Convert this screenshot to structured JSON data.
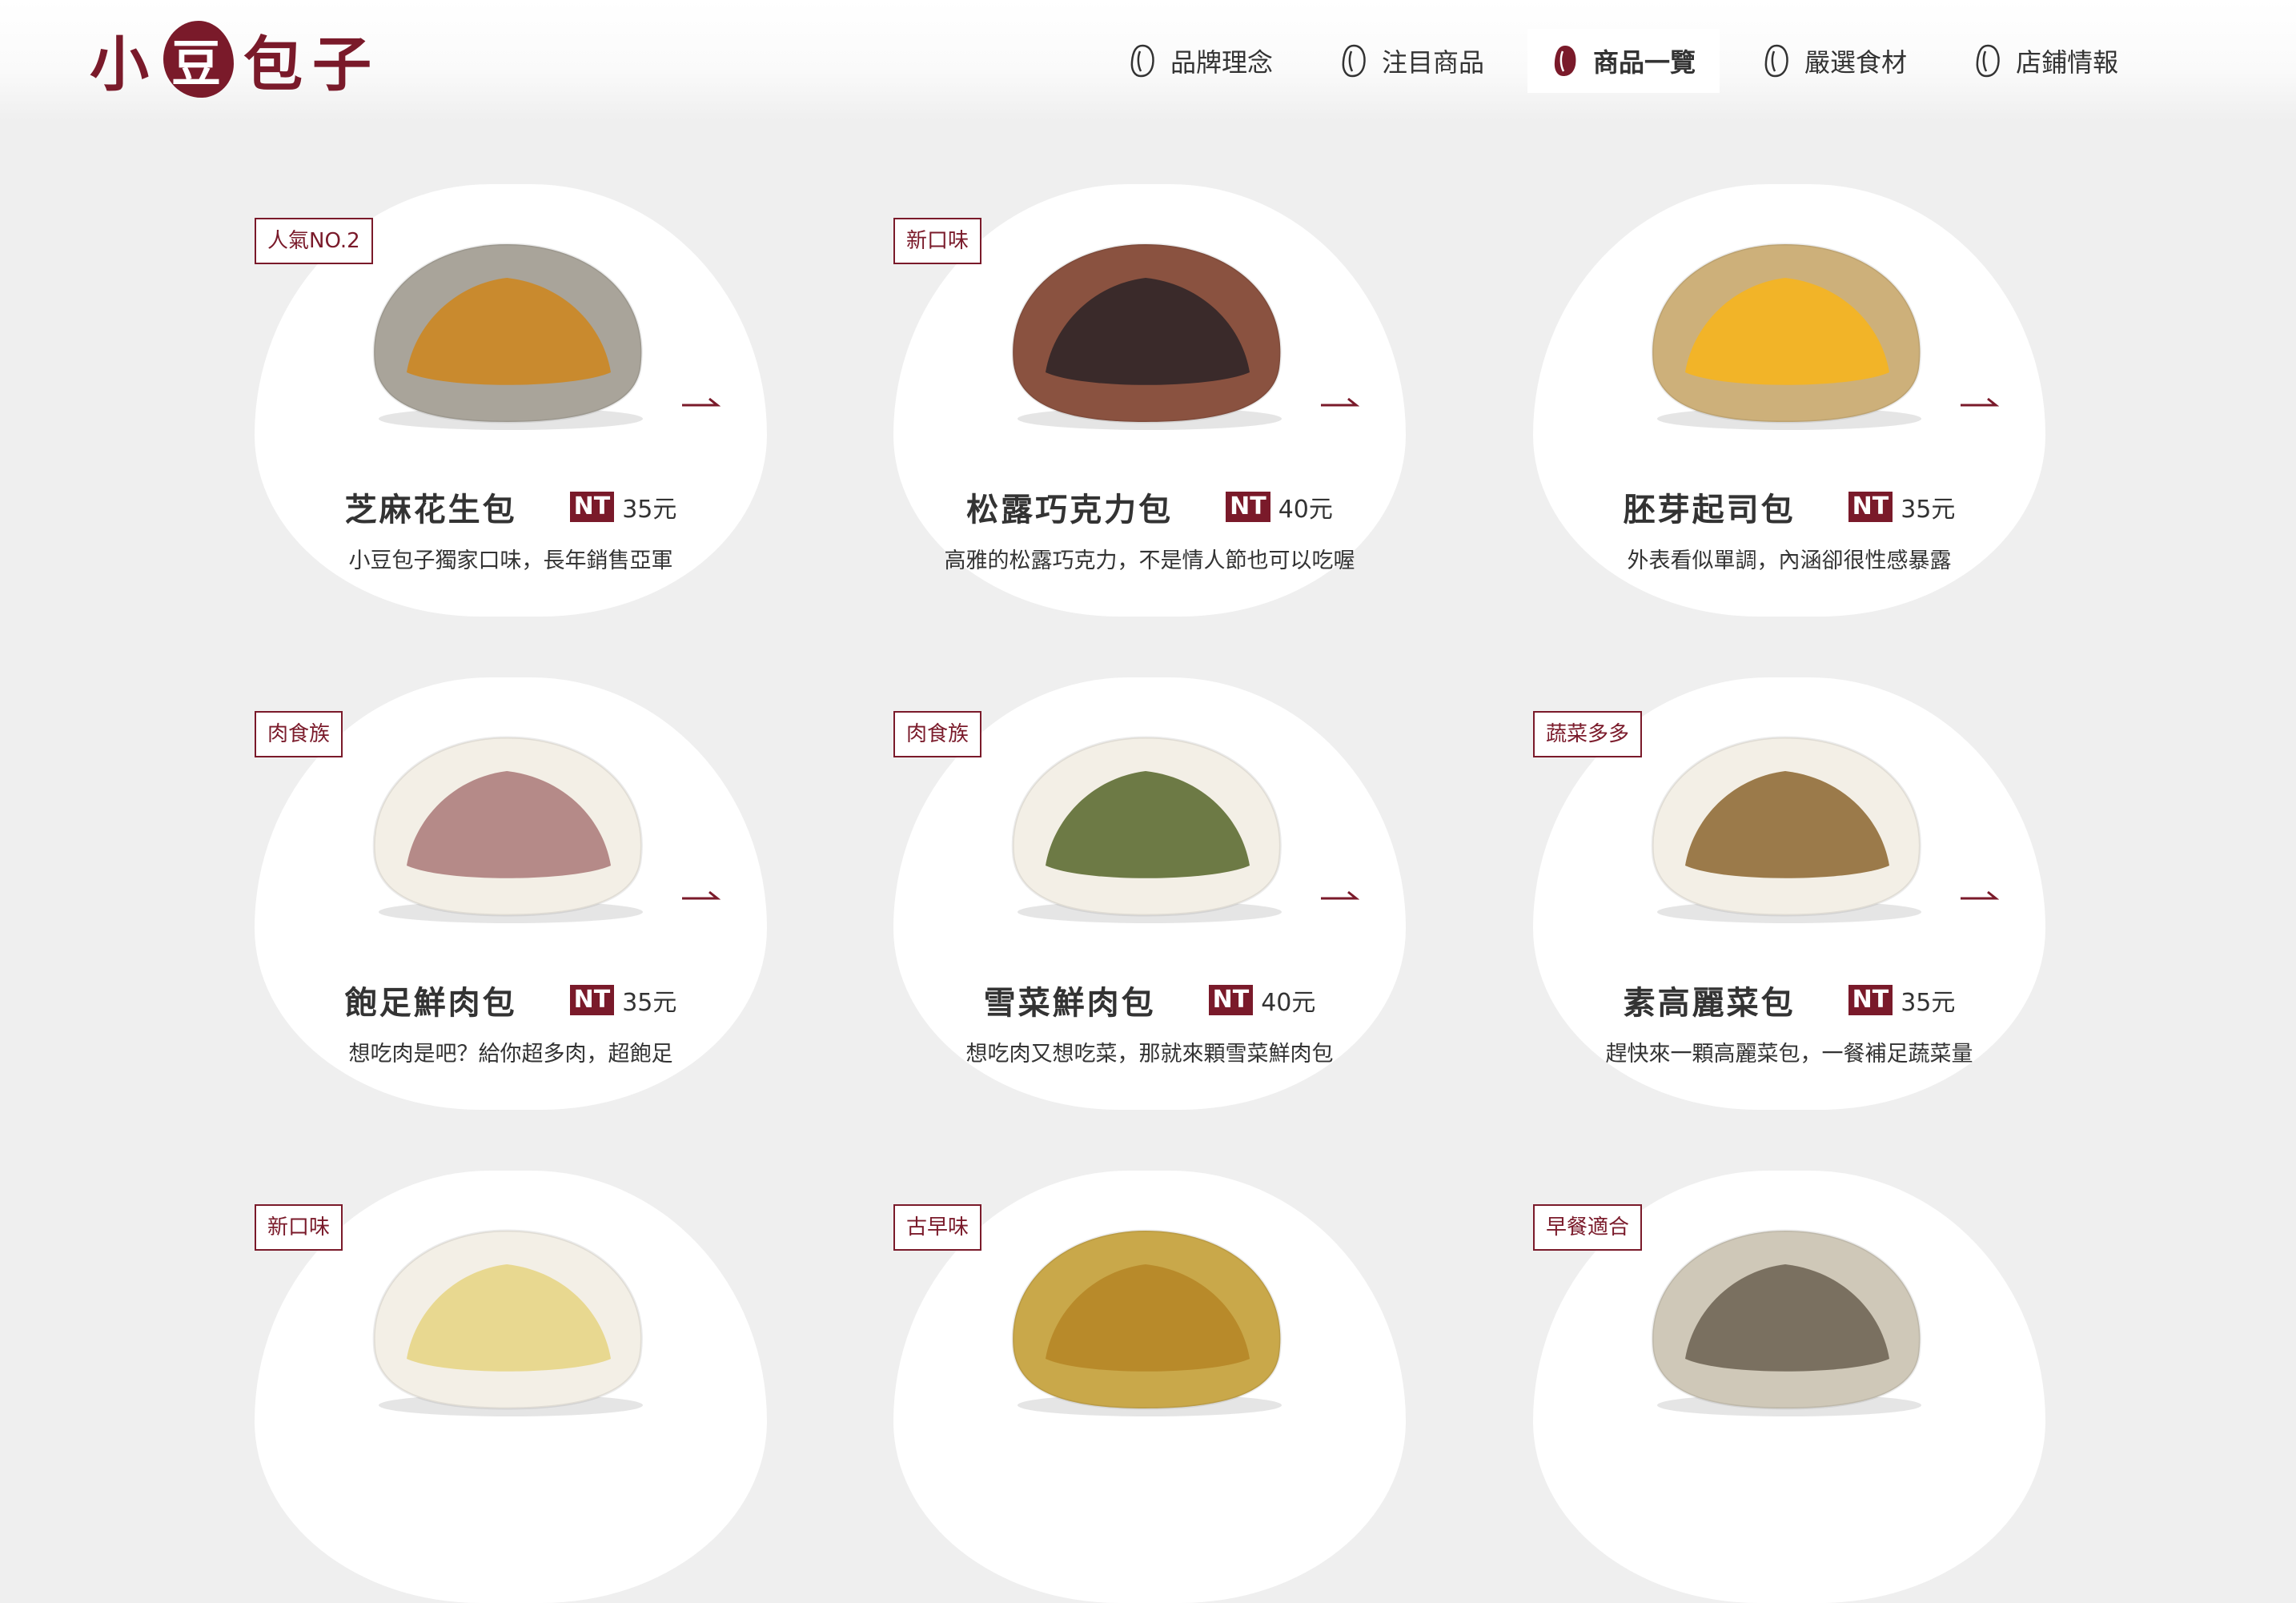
{
  "brand": {
    "logo_chars": [
      "小",
      "豆",
      "包",
      "子"
    ],
    "color": "#7a1a2a"
  },
  "nav": {
    "items": [
      {
        "label": "品牌理念",
        "icon": "bean-outline-icon"
      },
      {
        "label": "注目商品",
        "icon": "bean-outline-icon"
      },
      {
        "label": "商品一覽",
        "icon": "bean-filled-icon",
        "active": true
      },
      {
        "label": "嚴選食材",
        "icon": "bean-outline-icon"
      },
      {
        "label": "店鋪情報",
        "icon": "bean-outline-icon"
      }
    ]
  },
  "products": [
    {
      "badge": "人氣NO.2",
      "name": "芝麻花生包",
      "currency": "NT",
      "price": "35元",
      "desc": "小豆包子獨家口味，長年銷售亞軍",
      "dough": "#a9a49a",
      "filling": "#c98a2e"
    },
    {
      "badge": "新口味",
      "name": "松露巧克力包",
      "currency": "NT",
      "price": "40元",
      "desc": "高雅的松露巧克力，不是情人節也可以吃喔",
      "dough": "#8a5240",
      "filling": "#3a2a2a"
    },
    {
      "badge": "",
      "name": "胚芽起司包",
      "currency": "NT",
      "price": "35元",
      "desc": "外表看似單調，內涵卻很性感暴露",
      "dough": "#cdb07a",
      "filling": "#f2b428"
    },
    {
      "badge": "肉食族",
      "name": "飽足鮮肉包",
      "currency": "NT",
      "price": "35元",
      "desc": "想吃肉是吧？給你超多肉，超飽足",
      "dough": "#f3efe6",
      "filling": "#b58a88"
    },
    {
      "badge": "肉食族",
      "name": "雪菜鮮肉包",
      "currency": "NT",
      "price": "40元",
      "desc": "想吃肉又想吃菜，那就來顆雪菜鮮肉包",
      "dough": "#f3efe6",
      "filling": "#6d7a45"
    },
    {
      "badge": "蔬菜多多",
      "name": "素高麗菜包",
      "currency": "NT",
      "price": "35元",
      "desc": "趕快來一顆高麗菜包，一餐補足蔬菜量",
      "dough": "#f3efe6",
      "filling": "#9b7a4a"
    },
    {
      "badge": "新口味",
      "name": "",
      "currency": "",
      "price": "",
      "desc": "",
      "dough": "#f3efe6",
      "filling": "#e8d890"
    },
    {
      "badge": "古早味",
      "name": "",
      "currency": "",
      "price": "",
      "desc": "",
      "dough": "#c9a84a",
      "filling": "#b88a2a"
    },
    {
      "badge": "早餐適合",
      "name": "",
      "currency": "",
      "price": "",
      "desc": "",
      "dough": "#cfc8b8",
      "filling": "#7a7060"
    }
  ]
}
